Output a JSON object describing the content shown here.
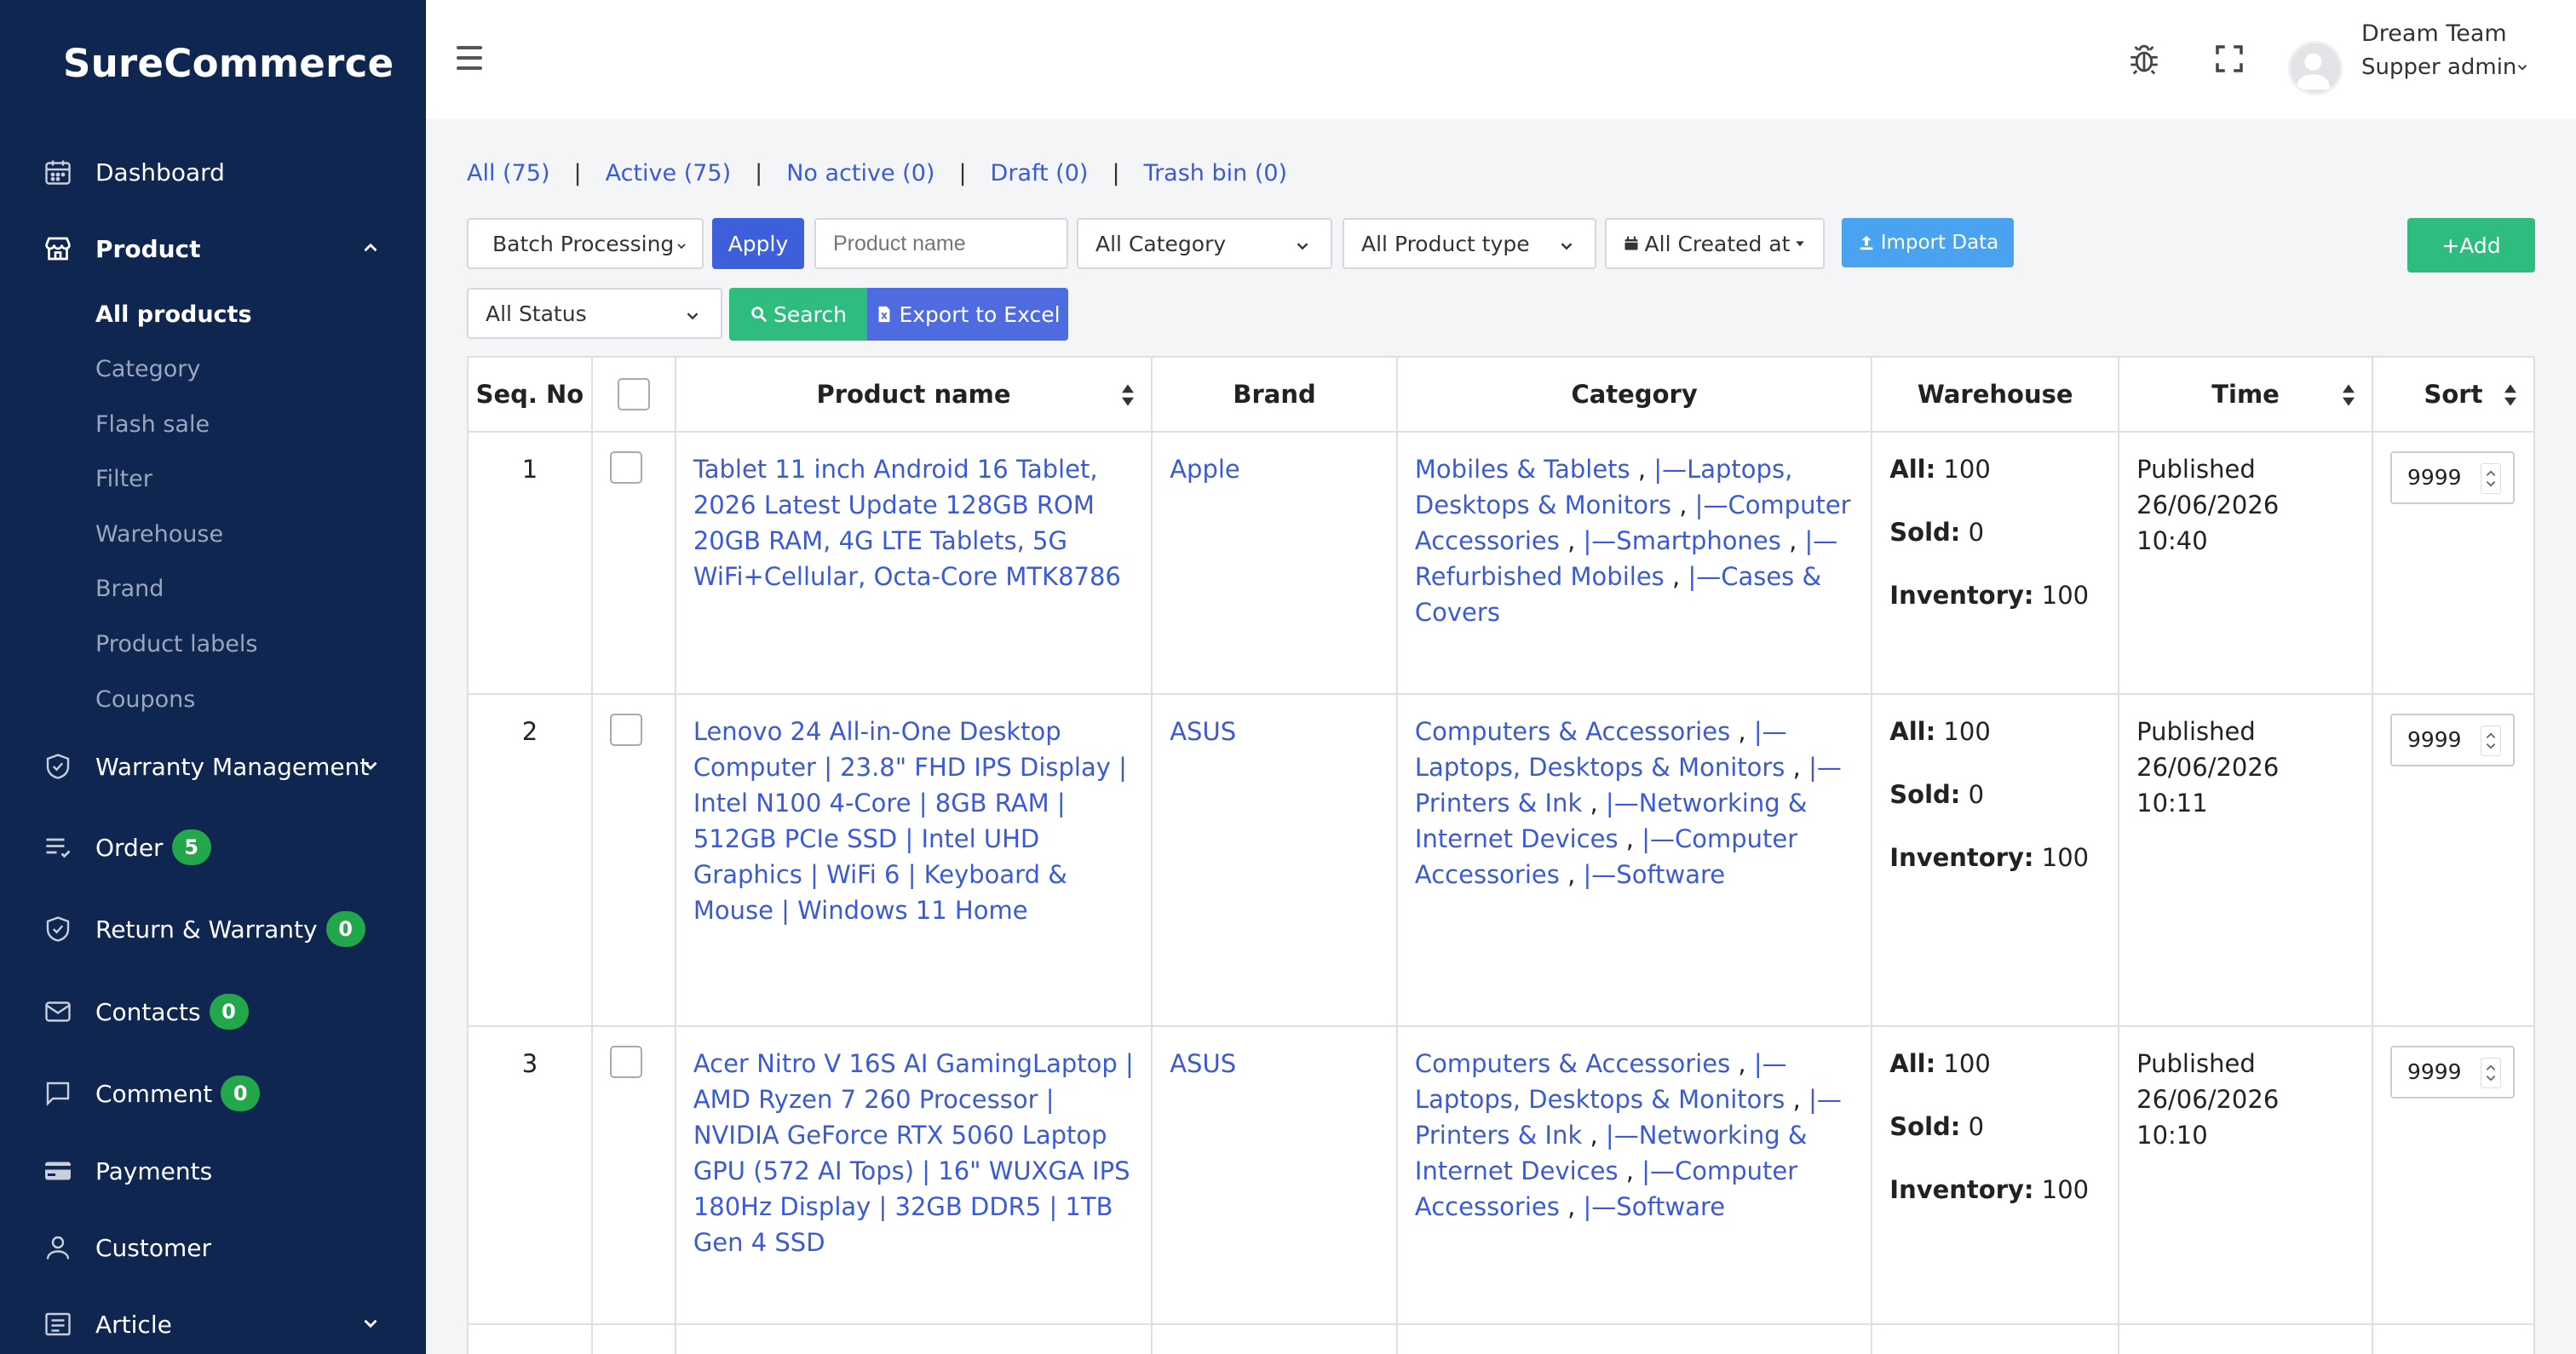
{
  "brand": "SureCommerce",
  "sidebar": {
    "dashboard": "Dashboard",
    "product": "Product",
    "sub_items": [
      "All products",
      "Category",
      "Flash sale",
      "Filter",
      "Warehouse",
      "Brand",
      "Product labels",
      "Coupons"
    ],
    "warranty_management": "Warranty Management",
    "order": "Order",
    "order_badge": "5",
    "return_warranty": "Return & Warranty",
    "return_badge": "0",
    "contacts": "Contacts",
    "contacts_badge": "0",
    "comment": "Comment",
    "comment_badge": "0",
    "payments": "Payments",
    "customer": "Customer",
    "article": "Article"
  },
  "header": {
    "user_name": "Dream Team",
    "user_role": "Supper admin"
  },
  "tabs": [
    "All (75)",
    "Active (75)",
    "No active (0)",
    "Draft (0)",
    "Trash bin (0)"
  ],
  "toolbar": {
    "batch": "Batch Processing",
    "apply": "Apply",
    "product_name_placeholder": "Product name",
    "category": "All Category",
    "product_type": "All Product type",
    "created_at": "All Created at",
    "import": "Import Data",
    "add": "+Add",
    "status": "All Status",
    "search": "Search",
    "export": "Export to Excel"
  },
  "table": {
    "headers": [
      "Seq. No",
      "Product name",
      "Brand",
      "Category",
      "Warehouse",
      "Time",
      "Sort"
    ],
    "labels": {
      "all": "All:",
      "sold": "Sold:",
      "inventory": "Inventory:"
    },
    "rows": [
      {
        "seq": "1",
        "name": "Tablet 11 inch Android 16 Tablet, 2026 Latest Update 128GB ROM 20GB RAM, 4G LTE Tablets, 5G WiFi+Cellular, Octa-Core MTK8786",
        "brand": "Apple",
        "categories": [
          "Mobiles & Tablets",
          "|—Laptops, Desktops & Monitors",
          "|—Computer Accessories",
          "|—Smartphones",
          "|—Refurbished Mobiles",
          "|—Cases & Covers"
        ],
        "all": "100",
        "sold": "0",
        "inventory": "100",
        "status": "Published",
        "time": "26/06/2026 10:40",
        "sort": "9999"
      },
      {
        "seq": "2",
        "name": "Lenovo 24 All-in-One Desktop Computer | 23.8\" FHD IPS Display | Intel N100 4-Core | 8GB RAM | 512GB PCIe SSD | Intel UHD Graphics | WiFi 6 | Keyboard & Mouse | Windows 11 Home",
        "brand": "ASUS",
        "categories": [
          "Computers & Accessories",
          "|—Laptops, Desktops & Monitors",
          "|—Printers & Ink",
          "|—Networking & Internet Devices",
          "|—Computer Accessories",
          "|—Software"
        ],
        "all": "100",
        "sold": "0",
        "inventory": "100",
        "status": "Published",
        "time": "26/06/2026 10:11",
        "sort": "9999"
      },
      {
        "seq": "3",
        "name": "Acer Nitro V 16S AI GamingLaptop | AMD Ryzen 7 260 Processor | NVIDIA GeForce RTX 5060 Laptop GPU (572 AI Tops) | 16\" WUXGA IPS 180Hz Display | 32GB DDR5 | 1TB Gen 4 SSD",
        "brand": "ASUS",
        "categories": [
          "Computers & Accessories",
          "|—Laptops, Desktops & Monitors",
          "|—Printers & Ink",
          "|—Networking & Internet Devices",
          "|—Computer Accessories",
          "|—Software"
        ],
        "all": "100",
        "sold": "0",
        "inventory": "100",
        "status": "Published",
        "time": "26/06/2026 10:10",
        "sort": "9999"
      }
    ]
  },
  "colors": {
    "sidebar_bg": "#0f2650",
    "link": "#3a5ad9",
    "green": "#2ebd7e",
    "badge": "#22a84a",
    "import": "#4aa3f0"
  }
}
